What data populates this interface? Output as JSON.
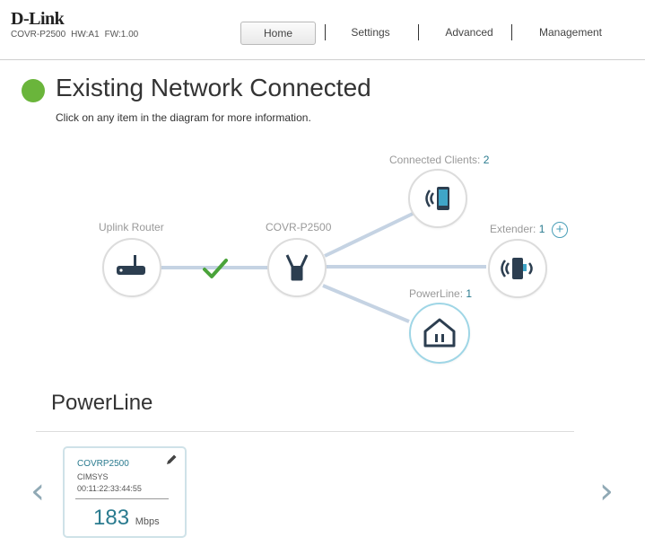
{
  "header": {
    "brand": "D-Link",
    "model": "COVR-P2500",
    "hw": "HW:A1",
    "fw": "FW:1.00",
    "tabs": [
      {
        "label": "Home"
      },
      {
        "label": "Settings"
      },
      {
        "label": "Advanced"
      },
      {
        "label": "Management"
      }
    ]
  },
  "banner": {
    "title": "Existing Network Connected",
    "subtitle": "Click on any item in the diagram for more information.",
    "status_color": "#6ab53b"
  },
  "diagram": {
    "uplink_label": "Uplink Router",
    "device_label": "COVR-P2500",
    "clients_label": "Connected Clients:",
    "clients_count": "2",
    "extender_label": "Extender:",
    "extender_count": "1",
    "powerline_label": "PowerLine:",
    "powerline_count": "1",
    "add_symbol": "+"
  },
  "section": {
    "title": "PowerLine"
  },
  "card": {
    "name": "COVRP2500",
    "subname": "CIMSYS",
    "mac": "00:11:22:33:44:55",
    "speed": "183",
    "unit": "Mbps"
  },
  "nav_arrows": {
    "prev": "‹",
    "next": "›"
  },
  "colors": {
    "accent": "#2a7b8f",
    "link_line": "#c5d3e3",
    "check": "#4aa33a"
  }
}
